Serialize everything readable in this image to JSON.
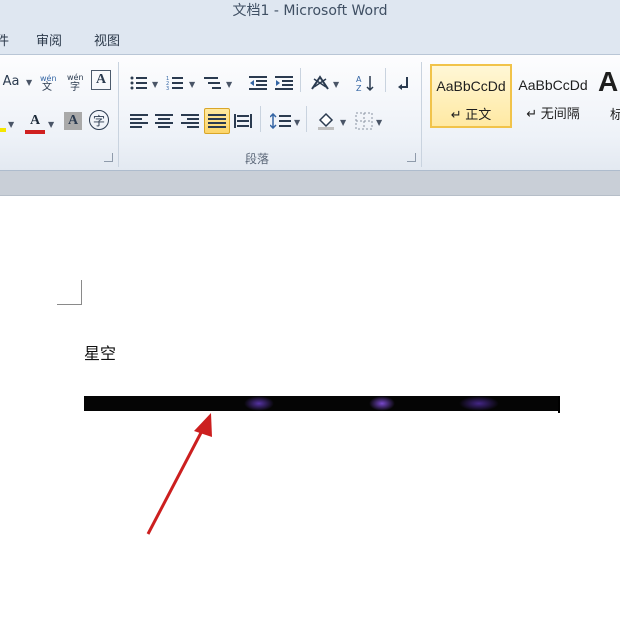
{
  "window": {
    "title": "文档1  -  Microsoft Word"
  },
  "tabs": [
    {
      "label": "件"
    },
    {
      "label": "审阅"
    },
    {
      "label": "视图"
    }
  ],
  "ribbon": {
    "font_group": {
      "change_case_label": "Aa",
      "font_color_label": "A",
      "char_shading_label": "A",
      "enclose_label": "字",
      "border_label": "A",
      "phonetic_label": "文"
    },
    "paragraph_group": {
      "label": "段落"
    },
    "styles": [
      {
        "preview": "AaBbCcDd",
        "name": "↵ 正文",
        "active": true
      },
      {
        "preview": "AaBbCcDd",
        "name": "↵ 无间隔",
        "active": false
      },
      {
        "preview": "A",
        "name": "标"
      }
    ]
  },
  "document": {
    "text": "星空"
  },
  "colors": {
    "accent_active_style": "#f1c34a",
    "font_color_red": "#d02020",
    "highlight_yellow": "#f5e600",
    "annotation_arrow": "#cc1f1f",
    "image_line": "#050505"
  }
}
